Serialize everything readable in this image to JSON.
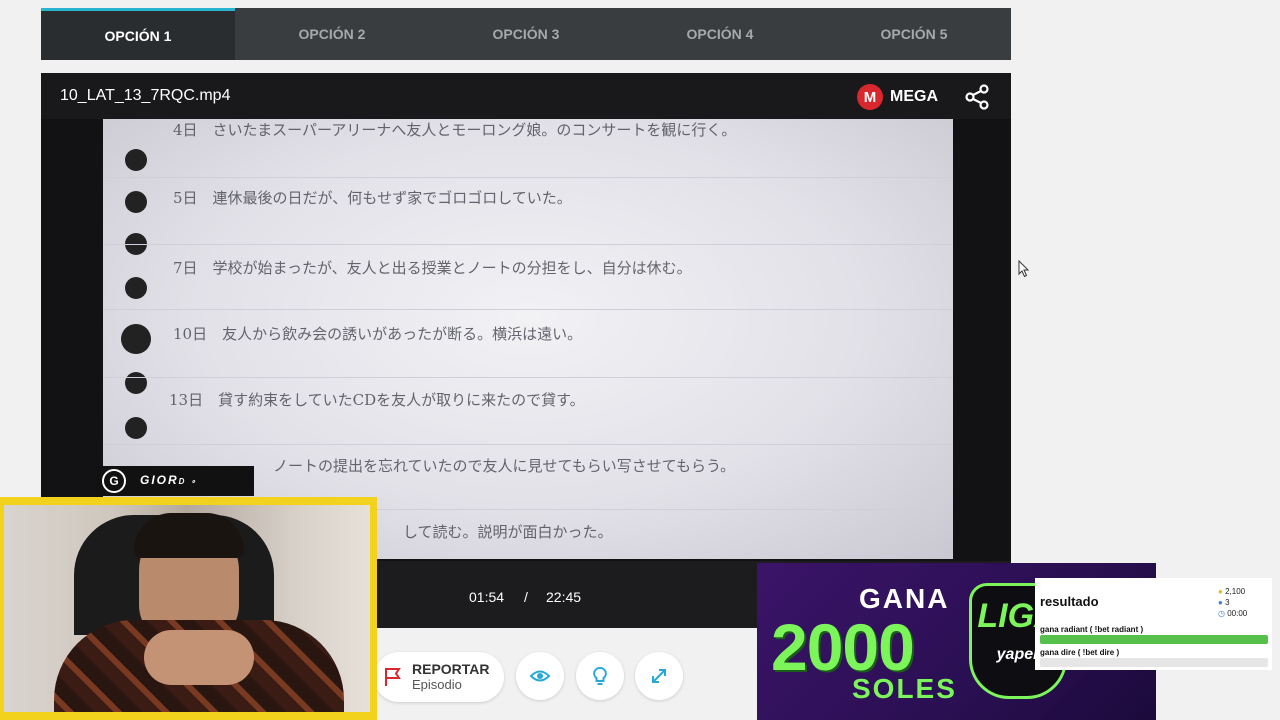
{
  "tabs": [
    {
      "label": "OPCIÓN 1",
      "active": true
    },
    {
      "label": "OPCIÓN 2",
      "active": false
    },
    {
      "label": "OPCIÓN 3",
      "active": false
    },
    {
      "label": "OPCIÓN 4",
      "active": false
    },
    {
      "label": "OPCIÓN 5",
      "active": false
    }
  ],
  "player": {
    "filename": "10_LAT_13_7RQC.mp4",
    "host_logo": "M",
    "host": "MEGA",
    "current_time": "01:54",
    "separator": "/",
    "total_time": "22:45",
    "video_text": {
      "line1": "4日　さいたまスーパーアリーナへ友人とモーロング娘。のコンサートを観に行く。",
      "line2": "5日　連休最後の日だが、何もせず家でゴロゴロしていた。",
      "line3": "7日　学校が始まったが、友人と出る授業とノートの分担をし、自分は休む。",
      "line4": "10日　友人から飲み会の誘いがあったが断る。横浜は遠い。",
      "line5": "13日　貸す約束をしていたCDを友人が取りに来たので貸す。",
      "line6": "ノートの提出を忘れていたので友人に見せてもらい写させてもらう。",
      "line7": "して読む。説明が面白かった。"
    }
  },
  "actions": {
    "report_title": "REPORTAR",
    "report_sub": "Episodio"
  },
  "overlay": {
    "webcam_name": "GIOR",
    "webcam_name_tail": "D ∘",
    "logo_glyph": "G"
  },
  "ad": {
    "line1": "GANA",
    "amount": "2000",
    "line3": "SOLES",
    "logo_text": "LIGA",
    "logo_sub": "yaper"
  },
  "poll": {
    "title": "resultado",
    "stat_points": "2,100",
    "stat_users": "3",
    "stat_time": "00:00",
    "option1": "gana radiant ( !bet radiant )",
    "option2": "gana dire ( !bet dire )",
    "option1_fraction": 1.0,
    "option2_fraction": 0.0
  },
  "colors": {
    "accent": "#2ab4d0",
    "mega_red": "#d9272e",
    "ad_green": "#7cf55a",
    "poll_bar": "#55c04a",
    "webcam_frame": "#f2d21c"
  }
}
